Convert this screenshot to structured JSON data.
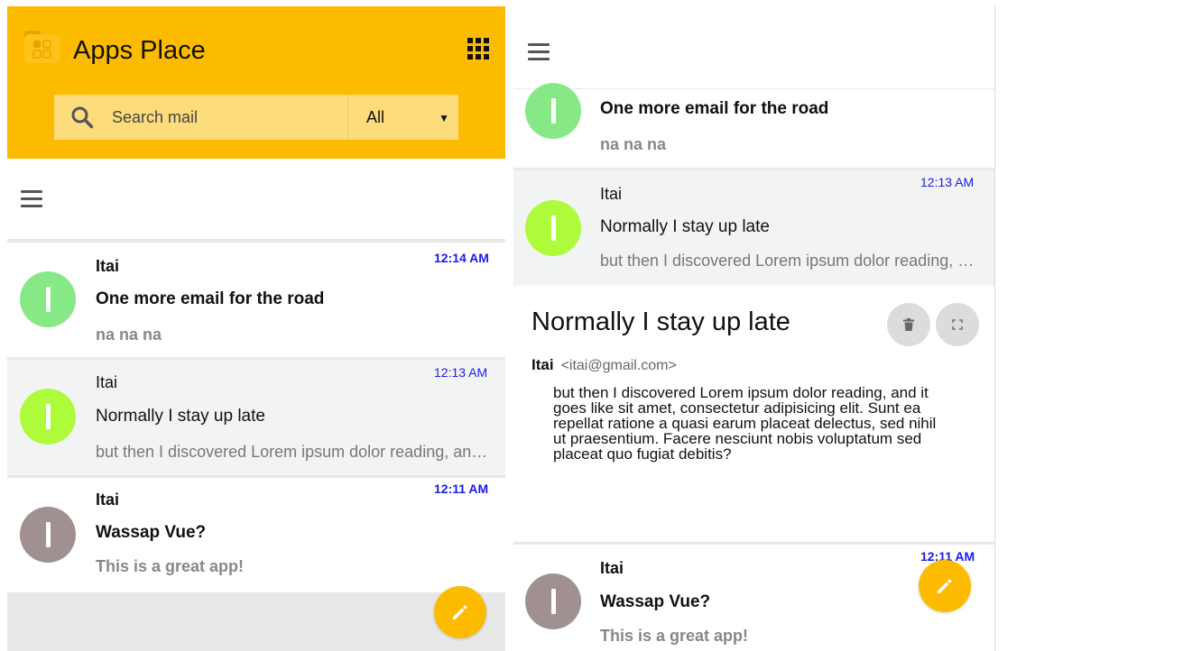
{
  "app": {
    "title": "Apps Place"
  },
  "search": {
    "placeholder": "Search mail",
    "filter_selected": "All"
  },
  "colors": {
    "accent": "#fdbb00",
    "time": "#1a1aee",
    "avatar_green": "#86e986",
    "avatar_lime": "#adfb3b",
    "avatar_mauve": "#a09090"
  },
  "list": [
    {
      "sender": "Itai",
      "subject": "One more email for the road",
      "preview": "na na na",
      "time": "12:14 AM",
      "unread": true
    },
    {
      "sender": "Itai",
      "subject": "Normally I stay up late",
      "preview": "but then I discovered Lorem ipsum dolor reading, and it goes like sit amet, consectetur adipisicing elit.",
      "time": "12:13 AM",
      "unread": false
    },
    {
      "sender": "Itai",
      "subject": "Wassap Vue?",
      "preview": "This is a great app!",
      "time": "12:11 AM",
      "unread": true
    }
  ],
  "detail": {
    "subject": "Normally I stay up late",
    "from_name": "Itai",
    "from_email": "<itai@gmail.com>",
    "body": "but then I discovered Lorem ipsum dolor reading, and it goes like sit amet, consectetur adipisicing elit. Sunt ea repellat ratione a quasi earum placeat delectus, sed nihil ut praesentium. Facere nesciunt nobis voluptatum sed placeat quo fugiat debitis?"
  },
  "icons": {
    "logo": "folder-apps-icon",
    "grid": "grid-apps-icon",
    "search": "search-icon",
    "menu": "hamburger-menu-icon",
    "delete": "trash-icon",
    "expand": "fullscreen-icon",
    "compose": "pencil-icon"
  }
}
